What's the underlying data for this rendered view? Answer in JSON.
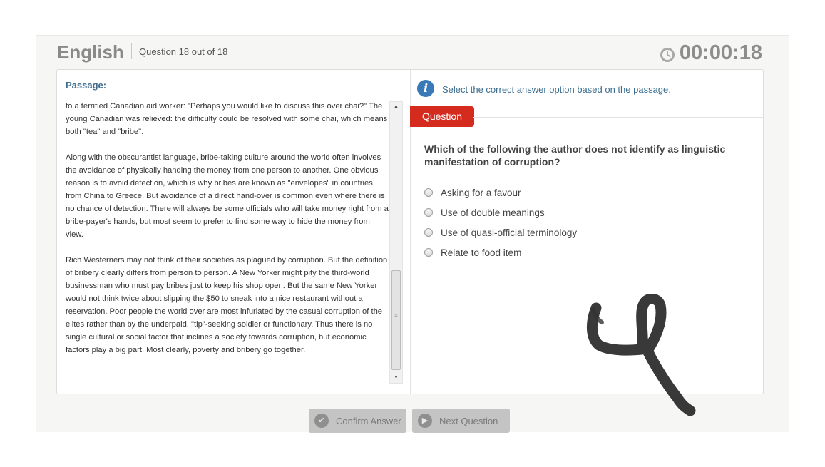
{
  "header": {
    "subject": "English",
    "question_counter": "Question 18 out of 18",
    "timer": "00:00:18"
  },
  "passage": {
    "label": "Passage:",
    "paragraphs": [
      "to a terrified Canadian aid worker: \"Perhaps you would like to discuss this over chai?\" The young Canadian was relieved: the difficulty could be resolved with some chai, which means both \"tea\" and \"bribe\".",
      "Along with the obscurantist language, bribe-taking culture around the world often involves the avoidance of physically handing the money from one person to another. One obvious reason is to avoid detection, which is why bribes are known as \"envelopes\" in countries from China to Greece. But avoidance of a direct hand-over is common even where there is no chance of detection. There will always be some officials who will take money right from a bribe-payer's hands, but most seem to prefer to find some way to hide the money from view.",
      "Rich Westerners may not think of their societies as plagued by corruption. But the definition of bribery clearly differs from person to person. A New Yorker might pity the third-world businessman who must pay bribes just to keep his shop open. But the same New Yorker would not think twice about slipping the $50 to sneak into a nice restaurant without a reservation. Poor people the world over are most infuriated by the casual corruption of the elites rather than by the underpaid, \"tip\"-seeking soldier or functionary. Thus there is no single cultural or social factor that inclines a society towards corruption, but economic factors play a big part. Most clearly, poverty and bribery go together."
    ]
  },
  "instruction": "Select the correct answer option based on the passage.",
  "question": {
    "tab_label": "Question",
    "text": "Which of the following the author does not identify as linguistic manifestation of corruption?",
    "options": [
      "Asking for a favour",
      "Use of double meanings",
      "Use of quasi-official terminology",
      "Relate to food item"
    ]
  },
  "buttons": {
    "confirm": "Confirm Answer",
    "next": "Next Question"
  },
  "icons": {
    "timer": "clock-icon",
    "info": "info-icon",
    "confirm": "check-icon",
    "next": "play-icon"
  },
  "colors": {
    "accent_red": "#d52b1e",
    "info_blue": "#3a79b7",
    "label_blue": "#3f6c8d",
    "button_gray": "#c4c4c4"
  }
}
